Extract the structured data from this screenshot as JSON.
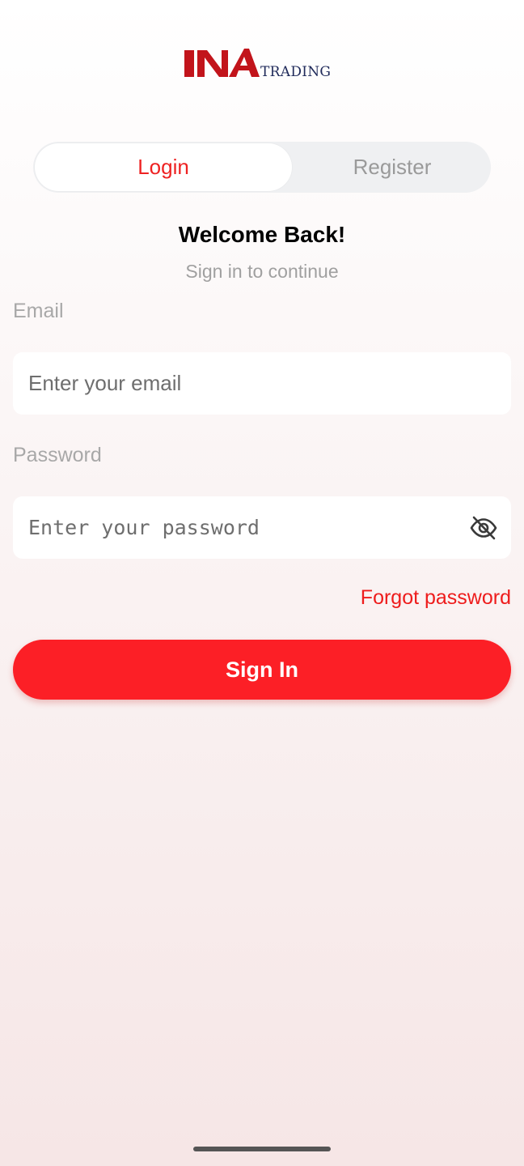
{
  "logo": {
    "brand": "INA",
    "suffix": "TRADING",
    "brand_color": "#c2141b",
    "suffix_color": "#1f2a5a"
  },
  "tabs": {
    "login_label": "Login",
    "register_label": "Register",
    "active": "Login"
  },
  "header": {
    "title": "Welcome Back!",
    "subtitle": "Sign in to continue"
  },
  "form": {
    "email_label": "Email",
    "email_placeholder": "Enter your email",
    "email_value": "",
    "password_label": "Password",
    "password_placeholder": "Enter your password",
    "password_value": "",
    "password_toggle_icon": "eye-off-icon",
    "forgot_label": "Forgot password",
    "submit_label": "Sign In"
  },
  "colors": {
    "accent": "#fc1f26",
    "link": "#ee1c1c",
    "muted": "#a0a0a0"
  }
}
